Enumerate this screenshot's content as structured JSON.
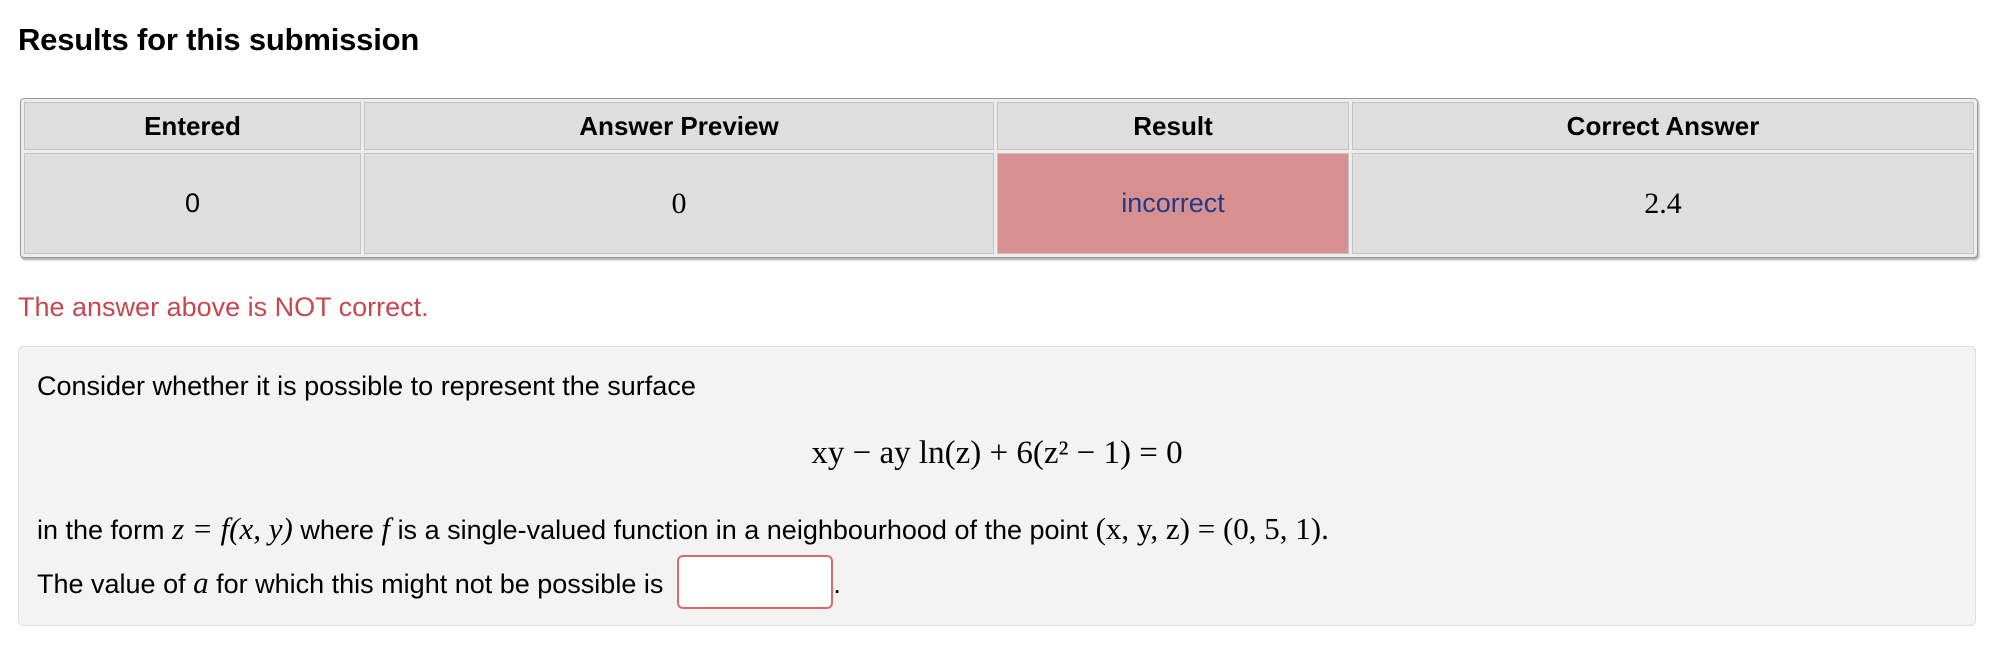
{
  "header": {
    "title": "Results for this submission"
  },
  "results_table": {
    "columns": [
      "Entered",
      "Answer Preview",
      "Result",
      "Correct Answer"
    ],
    "row": {
      "entered": "0",
      "preview": "0",
      "result": "incorrect",
      "correct": "2.4"
    }
  },
  "feedback": {
    "message": "The answer above is NOT correct."
  },
  "problem": {
    "intro": "Consider whether it is possible to represent the surface",
    "equation": "xy − ay ln(z) + 6(z² − 1) = 0",
    "line2_text1": "in the form",
    "line2_math1": "z = f(x, y)",
    "line2_text2": "where",
    "line2_math2": "f",
    "line2_text3": "is a single-valued function in a neighbourhood of the point",
    "line2_math3": "(x, y, z) = (0, 5, 1).",
    "line3_text1": "The value of",
    "line3_math1": "a",
    "line3_text2": "for which this might not be possible is",
    "answer_value": "",
    "answer_suffix": "."
  },
  "colors": {
    "incorrect_cell": "#d78f8f",
    "incorrect_text": "#1f3b8c",
    "feedback_text": "#c8474f",
    "input_border": "#d96b6b"
  }
}
